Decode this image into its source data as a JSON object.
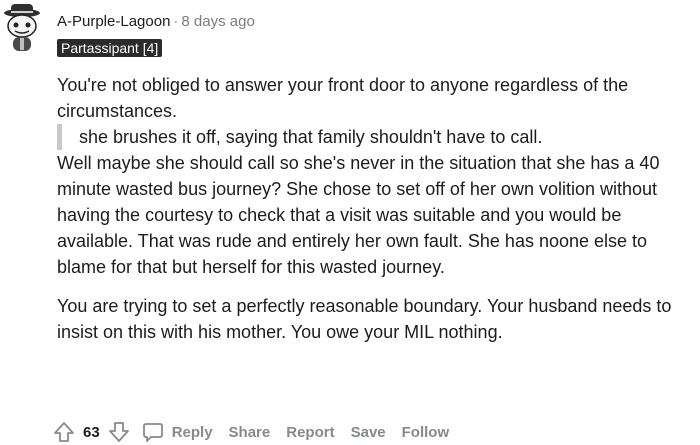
{
  "comment": {
    "username": "A-Purple-Lagoon",
    "separator": "·",
    "time": "8 days ago",
    "flair": "Partassipant [4]",
    "paragraph1": "You're not obliged to answer your front door to anyone regardless of the circumstances.",
    "quote": "she brushes it off, saying that family shouldn't have to call.",
    "paragraph2": "Well maybe she should call so she's never in the situation that she has a 40 minute wasted bus journey? She chose to set off of her own volition without having the courtesy to check that a visit was suitable and you would be available. That was rude and entirely her own fault. She has noone else to blame for that but herself for this wasted journey.",
    "paragraph3": "You are trying to set a perfectly reasonable boundary. Your husband needs to insist on this with his mother. You owe your MIL nothing."
  },
  "actions": {
    "score": "63",
    "reply": "Reply",
    "share": "Share",
    "report": "Report",
    "save": "Save",
    "follow": "Follow"
  },
  "icons": {
    "avatar": "reddit-snoo-hat-avatar-icon",
    "upvote": "upvote-arrow-icon",
    "downvote": "downvote-arrow-icon",
    "comment": "comment-bubble-icon"
  },
  "colors": {
    "text": "#1c1c1c",
    "muted": "#878a8c",
    "flair_bg": "#2b2b2b",
    "flair_text": "#ffffff",
    "quote_bar": "#c9c9c9"
  }
}
